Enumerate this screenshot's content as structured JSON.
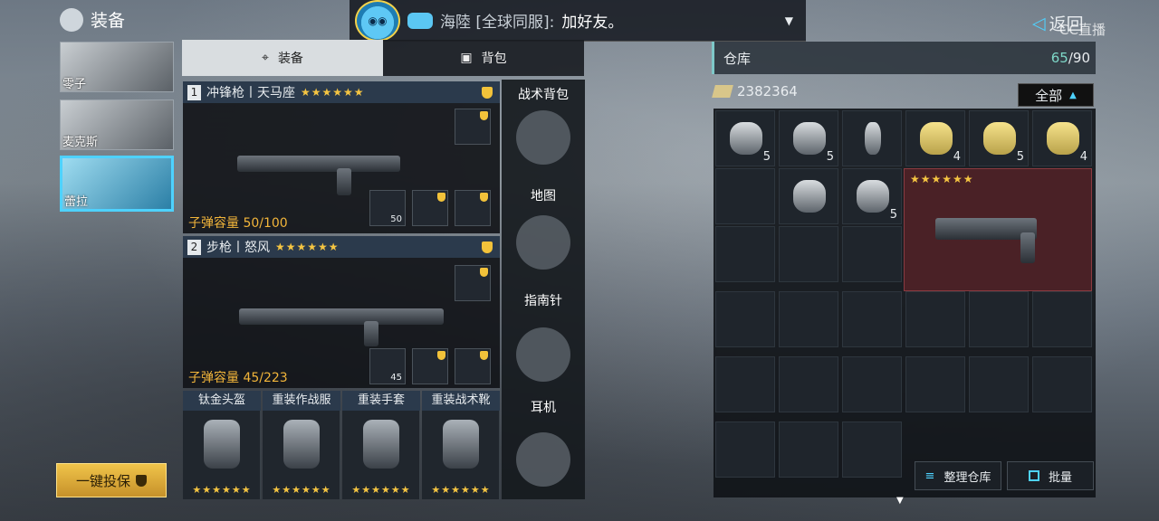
{
  "header": {
    "title": "装备",
    "back_label": "返回",
    "watermark": "CC直播"
  },
  "chat": {
    "channel": "海陸 [全球同服]:",
    "message": "加好友。"
  },
  "characters": [
    {
      "name": "零子"
    },
    {
      "name": "麦克斯"
    },
    {
      "name": "蕾拉"
    }
  ],
  "insure_label": "一键投保",
  "tabs": {
    "equip": "装备",
    "bag": "背包"
  },
  "weapons": [
    {
      "index": "1",
      "name": "冲锋枪丨天马座",
      "stars": "★★★★★★",
      "ammo": "子弹容量 50/100",
      "slot_qty": "50"
    },
    {
      "index": "2",
      "name": "步枪丨怒风",
      "stars": "★★★★★★",
      "ammo": "子弹容量 45/223",
      "slot_qty": "45"
    }
  ],
  "side": {
    "backpack": "战术背包",
    "map": "地图",
    "compass": "指南针",
    "headset": "耳机"
  },
  "armor": [
    {
      "name": "钛金头盔",
      "stars": "★★★★★★"
    },
    {
      "name": "重装作战服",
      "stars": "★★★★★★"
    },
    {
      "name": "重装手套",
      "stars": "★★★★★★"
    },
    {
      "name": "重装战术靴",
      "stars": "★★★★★★"
    }
  ],
  "warehouse": {
    "title": "仓库",
    "count": "65",
    "capacity": "/90",
    "money": "2382364",
    "filter": "全部",
    "items": [
      {
        "qty": "5"
      },
      {
        "qty": "5"
      },
      {
        "qty": ""
      },
      {
        "qty": "4"
      },
      {
        "qty": "5"
      },
      {
        "qty": "4"
      },
      {
        "qty": ""
      },
      {
        "qty": "5"
      }
    ],
    "big_item_stars": "★★★★★★",
    "sort_label": "整理仓库",
    "batch_label": "批量"
  }
}
